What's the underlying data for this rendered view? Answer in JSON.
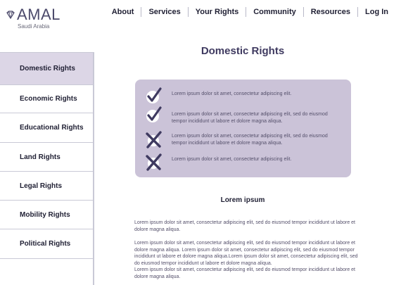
{
  "brand": {
    "name": "AMAL",
    "subtitle": "Saudi Arabia"
  },
  "nav": [
    "About",
    "Services",
    "Your Rights",
    "Community",
    "Resources",
    "Log In"
  ],
  "sidebar": {
    "active_index": 0,
    "items": [
      {
        "label": "Domestic Rights"
      },
      {
        "label": "Economic Rights"
      },
      {
        "label": "Educational Rights"
      },
      {
        "label": "Land Rights"
      },
      {
        "label": "Legal Rights"
      },
      {
        "label": "Mobility Rights"
      },
      {
        "label": "Political Rights"
      }
    ]
  },
  "page": {
    "title": "Domestic Rights",
    "section_title": "Lorem ipsum"
  },
  "checklist": [
    {
      "state": "check",
      "icon": "check-icon",
      "text": "Lorem ipsum dolor sit amet, consectetur adipiscing elit."
    },
    {
      "state": "check",
      "icon": "check-icon",
      "text": "Lorem ipsum dolor sit amet, consectetur adipiscing elit, sed do eiusmod tempor incididunt ut labore et dolore magna aliqua."
    },
    {
      "state": "cross",
      "icon": "cross-icon",
      "text": "Lorem ipsum dolor sit amet, consectetur adipiscing elit, sed do eiusmod tempor incididunt ut labore et dolore magna aliqua."
    },
    {
      "state": "cross",
      "icon": "cross-icon",
      "text": "Lorem ipsum dolor sit amet, consectetur adipiscing elit."
    }
  ],
  "paragraphs": [
    "Lorem ipsum dolor sit amet, consectetur adipiscing elit, sed do eiusmod tempor incididunt ut labore et dolore magna aliqua.",
    "Lorem ipsum dolor sit amet, consectetur adipiscing elit, sed do eiusmod tempor incididunt ut labore et dolore magna aliqua. Lorem ipsum dolor sit amet, consectetur adipiscing elit, sed do eiusmod tempor incididunt ut labore et dolore magna aliqua.Lorem ipsum dolor sit amet, consectetur adipiscing elit, sed do eiusmod tempor incididunt ut labore et dolore magna aliqua.",
    "Lorem ipsum dolor sit amet, consectetur adipiscing elit, sed do eiusmod tempor incididunt ut labore et dolore magna aliqua."
  ],
  "colors": {
    "accent": "#3f3a60",
    "panel": "#cbc3d8",
    "active_sidebar": "#dcd6e6"
  }
}
